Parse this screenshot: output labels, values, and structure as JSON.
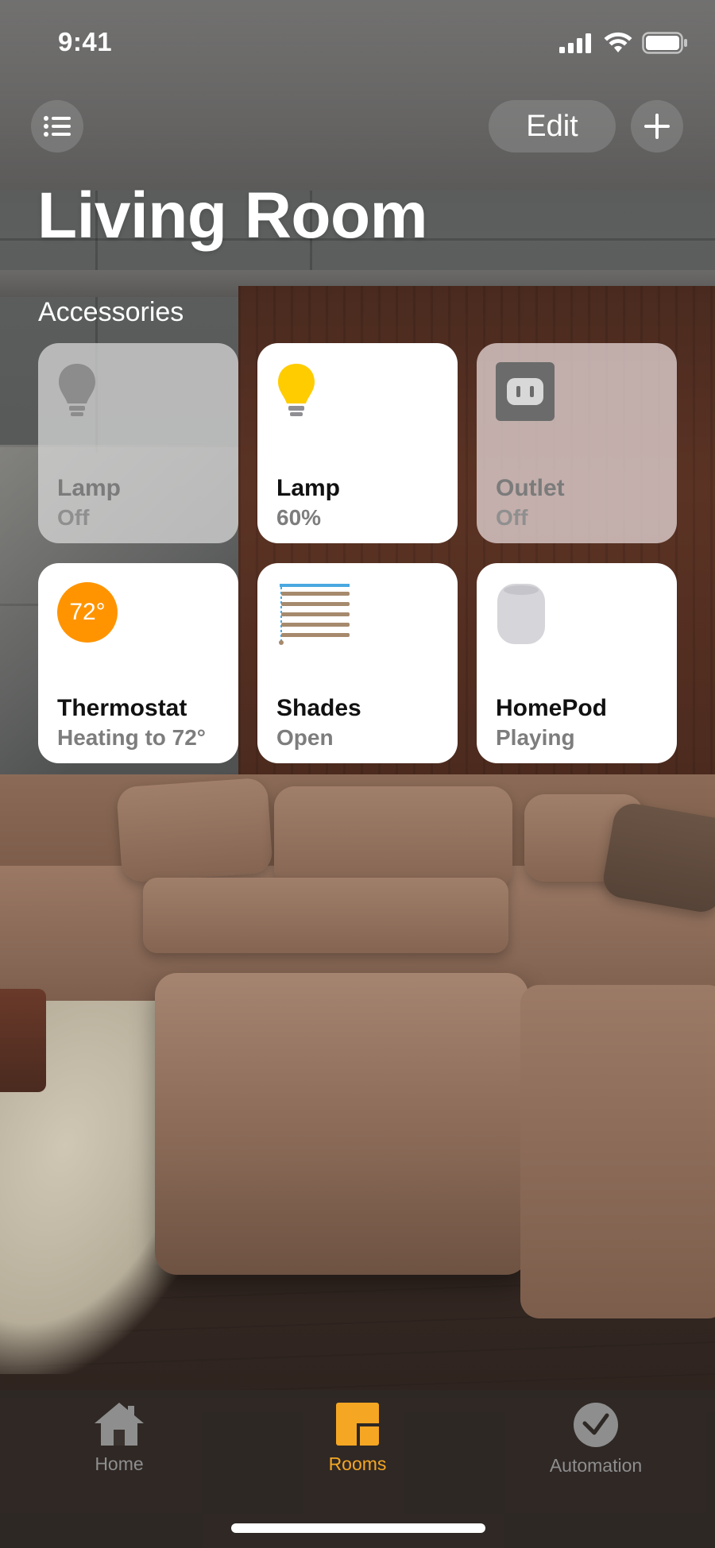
{
  "status_bar": {
    "time": "9:41"
  },
  "header": {
    "menu_icon": "list-icon",
    "edit_label": "Edit",
    "add_icon": "plus-icon",
    "title": "Living Room"
  },
  "accessories": {
    "section_title": "Accessories",
    "tiles": [
      {
        "name": "Lamp",
        "state": "Off",
        "icon": "lightbulb-off-icon",
        "on": false
      },
      {
        "name": "Lamp",
        "state": "60%",
        "icon": "lightbulb-on-icon",
        "on": true
      },
      {
        "name": "Outlet",
        "state": "Off",
        "icon": "outlet-icon",
        "on": false
      },
      {
        "name": "Thermostat",
        "state": "Heating to 72°",
        "icon": "thermostat-icon",
        "badge": "72°",
        "on": true
      },
      {
        "name": "Shades",
        "state": "Open",
        "icon": "shades-icon",
        "on": true
      },
      {
        "name": "HomePod",
        "state": "Playing",
        "icon": "homepod-icon",
        "on": true
      }
    ]
  },
  "tab_bar": {
    "tabs": [
      {
        "label": "Home",
        "icon": "house-icon",
        "active": false
      },
      {
        "label": "Rooms",
        "icon": "rooms-icon",
        "active": true
      },
      {
        "label": "Automation",
        "icon": "clock-check-icon",
        "active": false
      }
    ]
  },
  "colors": {
    "accent": "#f5a623",
    "thermostat": "#ff9400",
    "lamp_on": "#ffcc00",
    "tab_inactive": "#8e8e8e"
  }
}
